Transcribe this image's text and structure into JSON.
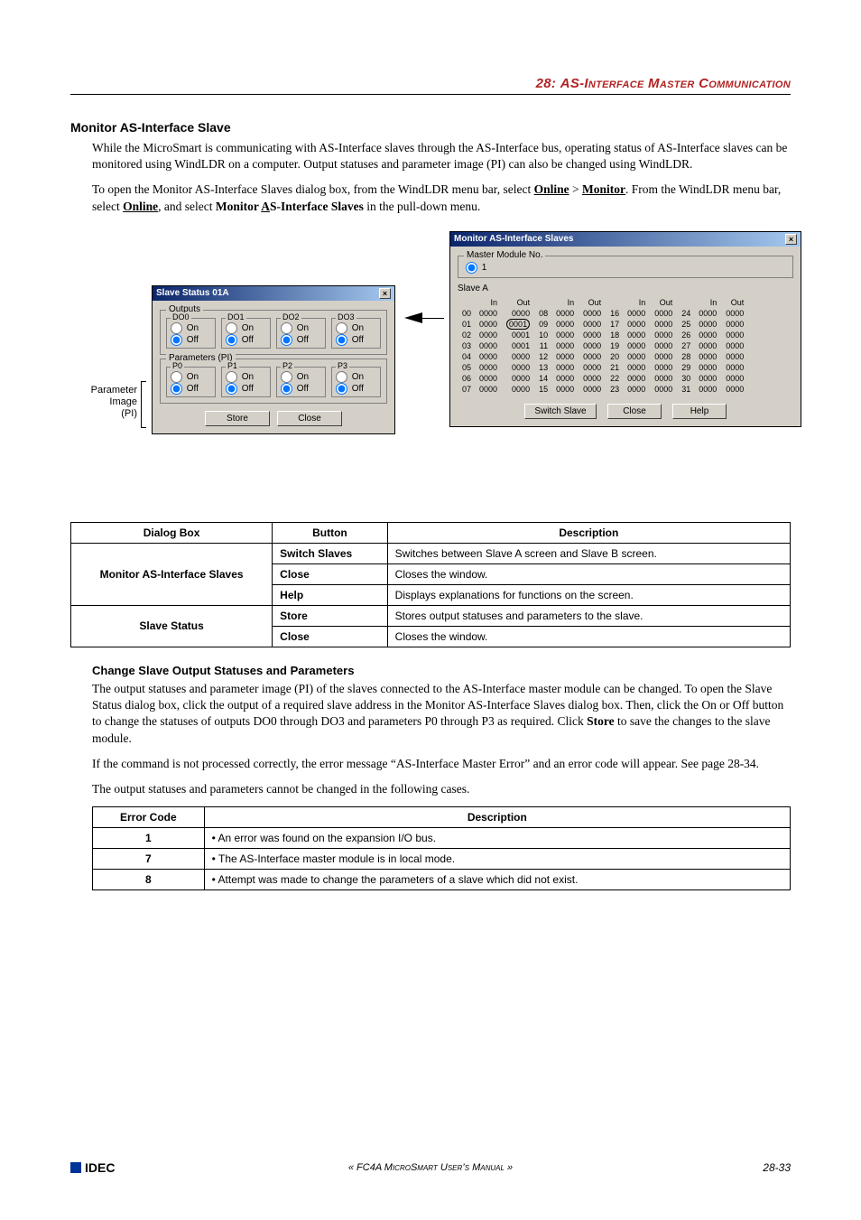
{
  "chapter": {
    "num": "28:",
    "title": "AS-Interface Master Communication"
  },
  "section1": {
    "title": "Monitor AS-Interface Slave",
    "p1": "While the MicroSmart is communicating with AS-Interface slaves through the AS-Interface bus, operating status of AS-Interface slaves can be monitored using WindLDR on a computer. Output statuses and parameter image (PI) can also be changed using WindLDR.",
    "p2a": "To open the Monitor AS-Interface Slaves dialog box, from the WindLDR menu bar, select ",
    "p2b_online": "Online",
    "p2b_gt": " > ",
    "p2b_monitor": "Monitor",
    "p2c": ". From the WindLDR menu bar, select ",
    "p2d_online": "Online",
    "p2e": ", and select ",
    "p2f_mas_monitor": "Monitor ",
    "p2f_mas_a": "A",
    "p2f_mas_rest": "S-Interface Slaves",
    "p2g": " in the pull-down menu."
  },
  "shotLabels": {
    "param": "Parameter\nImage\n(PI)"
  },
  "dlgStatus": {
    "title": "Slave Status 01A",
    "outputs_legend": "Outputs",
    "params_legend": "Parameters (PI)",
    "DO": [
      "DO0",
      "DO1",
      "DO2",
      "DO3"
    ],
    "P": [
      "P0",
      "P1",
      "P2",
      "P3"
    ],
    "on": "On",
    "off": "Off",
    "store": "Store",
    "close": "Close"
  },
  "dlgMon": {
    "title": "Monitor AS-Interface Slaves",
    "master_legend": "Master Module No.",
    "radio1": "1",
    "slaveA": "Slave A",
    "hdr_in": "In",
    "hdr_out": "Out",
    "switch": "Switch Slave",
    "close": "Close",
    "help": "Help",
    "rows": [
      [
        "00",
        "0000",
        "0000",
        "08",
        "0000",
        "0000",
        "16",
        "0000",
        "0000",
        "24",
        "0000",
        "0000"
      ],
      [
        "01",
        "0000",
        "0001",
        "09",
        "0000",
        "0000",
        "17",
        "0000",
        "0000",
        "25",
        "0000",
        "0000"
      ],
      [
        "02",
        "0000",
        "0001",
        "10",
        "0000",
        "0000",
        "18",
        "0000",
        "0000",
        "26",
        "0000",
        "0000"
      ],
      [
        "03",
        "0000",
        "0001",
        "11",
        "0000",
        "0000",
        "19",
        "0000",
        "0000",
        "27",
        "0000",
        "0000"
      ],
      [
        "04",
        "0000",
        "0000",
        "12",
        "0000",
        "0000",
        "20",
        "0000",
        "0000",
        "28",
        "0000",
        "0000"
      ],
      [
        "05",
        "0000",
        "0000",
        "13",
        "0000",
        "0000",
        "21",
        "0000",
        "0000",
        "29",
        "0000",
        "0000"
      ],
      [
        "06",
        "0000",
        "0000",
        "14",
        "0000",
        "0000",
        "22",
        "0000",
        "0000",
        "30",
        "0000",
        "0000"
      ],
      [
        "07",
        "0000",
        "0000",
        "15",
        "0000",
        "0000",
        "23",
        "0000",
        "0000",
        "31",
        "0000",
        "0000"
      ]
    ]
  },
  "tbl1": {
    "h1": "Dialog Box",
    "h2": "Button",
    "h3": "Description",
    "r": [
      {
        "db": "Monitor AS-Interface Slaves",
        "btn": "Switch Slaves",
        "desc": "Switches between Slave A screen and Slave B screen."
      },
      {
        "btn": "Close",
        "desc": "Closes the window."
      },
      {
        "btn": "Help",
        "desc": "Displays explanations for functions on the screen."
      },
      {
        "db": "Slave Status",
        "btn": "Store",
        "desc": "Stores output statuses and parameters to the slave."
      },
      {
        "btn": "Close",
        "desc": "Closes the window."
      }
    ]
  },
  "section2": {
    "title": "Change Slave Output Statuses and Parameters",
    "p1": "The output statuses and parameter image (PI) of the slaves connected to the AS-Interface master module can be changed. To open the Slave Status dialog box, click the output of a required slave address in the Monitor AS-Interface Slaves dialog box. Then, click the On or Off button to change the statuses of outputs DO0 through DO3 and parameters P0 through P3 as required. Click ",
    "p1_store": "Store",
    "p1b": " to save the changes to the slave module.",
    "p2": "If the command is not processed correctly, the error message “AS-Interface Master Error” and an error code will appear. See page 28-34.",
    "p3": "The output statuses and parameters cannot be changed in the following cases."
  },
  "tbl2": {
    "h1": "Error Code",
    "h2": "Description",
    "r": [
      {
        "c": "1",
        "d": "• An error was found on the expansion I/O bus."
      },
      {
        "c": "7",
        "d": "• The AS-Interface master module is in local mode."
      },
      {
        "c": "8",
        "d": "• Attempt was made to change the parameters of a slave which did not exist."
      }
    ]
  },
  "footer": {
    "brand": "IDEC",
    "center": "« FC4A MicroSmart User’s Manual »",
    "page": "28-33"
  }
}
